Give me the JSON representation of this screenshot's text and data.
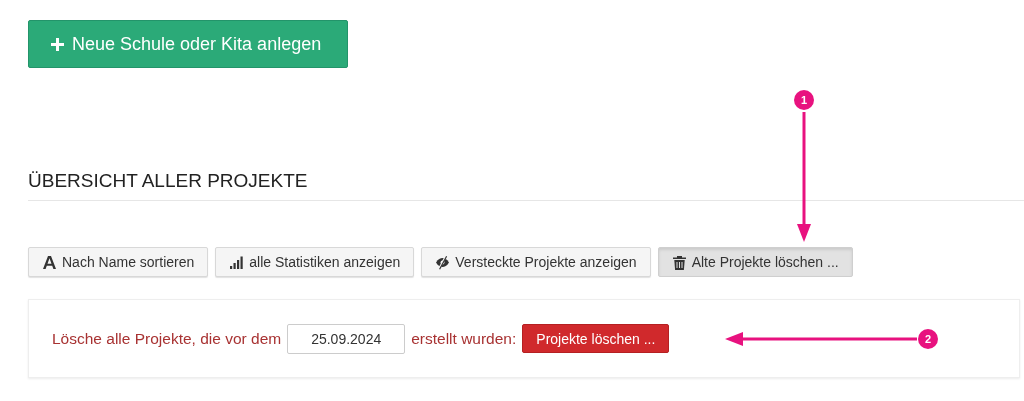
{
  "create_button": {
    "label": "Neue Schule oder Kita anlegen"
  },
  "section": {
    "title": "ÜBERSICHT ALLER PROJEKTE"
  },
  "toolbar": [
    {
      "label": "Nach Name sortieren",
      "selected": false
    },
    {
      "label": "alle Statistiken anzeigen",
      "selected": false
    },
    {
      "label": "Versteckte Projekte anzeigen",
      "selected": false
    },
    {
      "label": "Alte Projekte löschen ...",
      "selected": true
    }
  ],
  "delete_panel": {
    "text_before": "Lösche alle Projekte, die vor dem",
    "date": "25.09.2024",
    "text_after": "erstellt wurden:",
    "button": "Projekte löschen ..."
  },
  "annotations": [
    {
      "number": "1"
    },
    {
      "number": "2"
    }
  ]
}
